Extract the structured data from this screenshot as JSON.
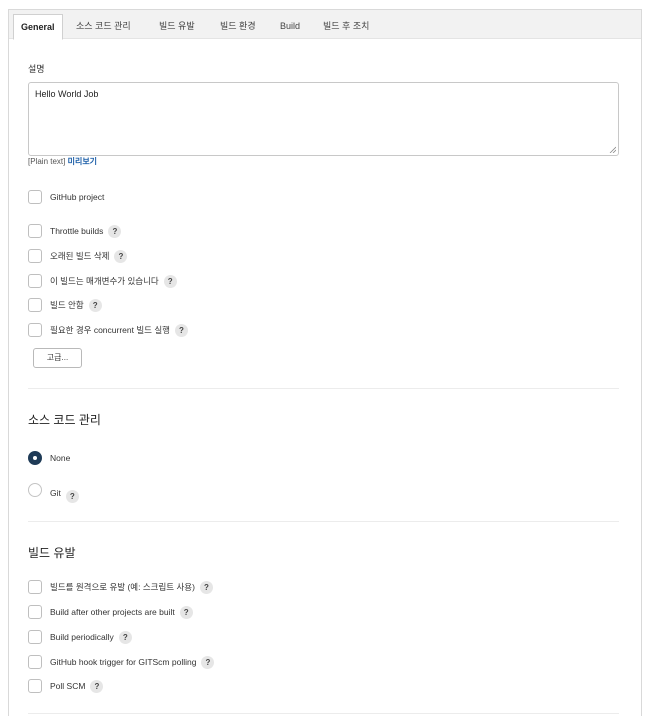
{
  "tabs": [
    "General",
    "소스 코드 관리",
    "빌드 유발",
    "빌드 환경",
    "Build",
    "빌드 후 조치"
  ],
  "general": {
    "description_label": "설명",
    "description_value": "Hello World Job",
    "format_hint": "[Plain text]",
    "preview_link": "미리보기",
    "github_project": "GitHub project",
    "options": [
      "Throttle builds",
      "오래된 빌드 삭제",
      "이 빌드는 매개변수가 있습니다",
      "빌드 안함",
      "필요한 경우 concurrent 빌드 실행"
    ],
    "advanced_button": "고급..."
  },
  "scm": {
    "title": "소스 코드 관리",
    "none_label": "None",
    "git_label": "Git",
    "selected": "None"
  },
  "triggers": {
    "title": "빌드 유발",
    "options": [
      "빌드를 원격으로 유발 (예: 스크립트 사용)",
      "Build after other projects are built",
      "Build periodically",
      "GitHub hook trigger for GITScm polling",
      "Poll SCM"
    ]
  },
  "help_symbol": "?",
  "colors": {
    "radio_selected": "#1f3b57",
    "link": "#1b5ea8",
    "tab_bar": "#f2f2f2"
  }
}
